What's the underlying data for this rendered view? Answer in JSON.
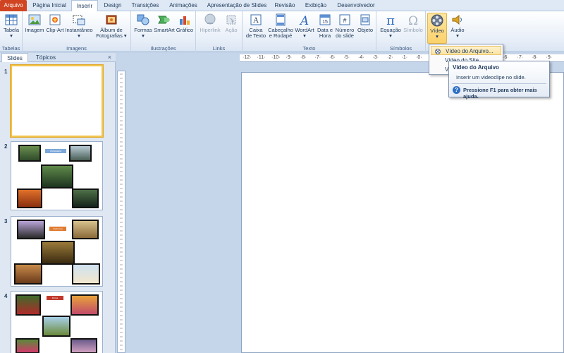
{
  "tabs": [
    "Arquivo",
    "Página Inicial",
    "Inserir",
    "Design",
    "Transições",
    "Animações",
    "Apresentação de Slides",
    "Revisão",
    "Exibição",
    "Desenvolvedor"
  ],
  "groups": {
    "tabelas": "Tabelas",
    "imagens": "Imagens",
    "ilustracoes": "Ilustrações",
    "links": "Links",
    "texto": "Texto",
    "simbolos": "Símbolos"
  },
  "commands": {
    "tabela": "Tabela",
    "imagem": "Imagem",
    "clipart": "Clip-Art",
    "instantaneo": "Instantâneo",
    "album1": "Álbum de",
    "album2": "Fotografias",
    "formas": "Formas",
    "smartart": "SmartArt",
    "grafico": "Gráfico",
    "hiperlink": "Hiperlink",
    "acao": "Ação",
    "caixa1": "Caixa",
    "caixa2": "de Texto",
    "cab1": "Cabeçalho",
    "cab2": "e Rodapé",
    "wordart": "WordArt",
    "data1": "Data e",
    "data2": "Hora",
    "num1": "Número",
    "num2": "do slide",
    "objeto": "Objeto",
    "equacao": "Equação",
    "simbolo": "Símbolo",
    "video": "Vídeo",
    "audio": "Áudio"
  },
  "panel": {
    "tab_slides": "Slides",
    "tab_topicos": "Tópicos",
    "close": "×",
    "numbers": [
      "1",
      "2",
      "3",
      "4"
    ],
    "slide2_label": "PAISAGEM",
    "slide3_label": "Cachorros",
    "slide4_label": "Flores"
  },
  "ruler": [
    "·12·",
    "·11·",
    "·10·",
    "·9·",
    "·8·",
    "·7·",
    "·6·",
    "·5·",
    "·4·",
    "·3·",
    "·2·",
    "·1·",
    "·0·",
    "·1·",
    "·2·",
    "·3·",
    "·4·",
    "·5·",
    "·6·",
    "·7·",
    "·8·",
    "·9·"
  ],
  "dropdown": {
    "item1": "Vídeo do Arquivo...",
    "item2": "Vídeo do Site...",
    "item3": "Vídeo"
  },
  "tooltip": {
    "title": "Vídeo do Arquivo",
    "desc": "Inserir um videoclipe no slide.",
    "help": "Pressione F1 para obter mais ajuda."
  },
  "colors": {
    "file_tab": "#d04422",
    "accent": "#2d6fc4",
    "highlight": "#fbd26b"
  }
}
